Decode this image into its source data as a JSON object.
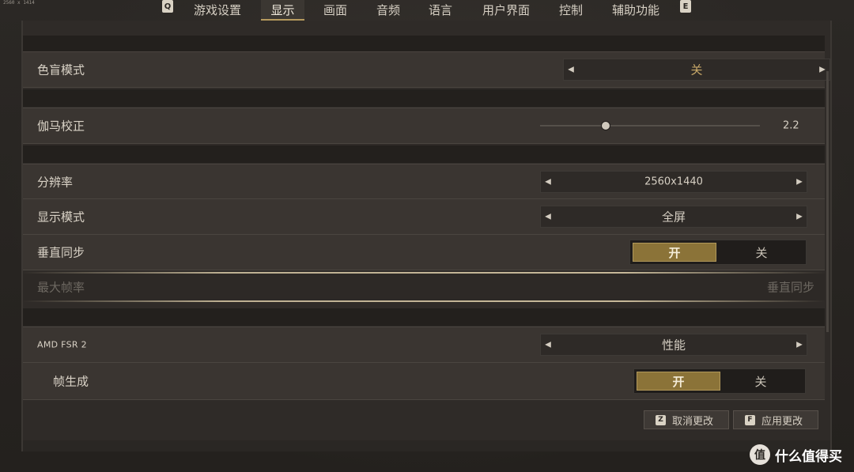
{
  "resolution_label": "2560 x 1414",
  "nav": {
    "left_key": "Q",
    "right_key": "E",
    "tabs": [
      "游戏设置",
      "显示",
      "画面",
      "音频",
      "语言",
      "用户界面",
      "控制",
      "辅助功能"
    ],
    "active_tab": "显示"
  },
  "settings": {
    "colorblind": {
      "label": "色盲模式",
      "value": "关"
    },
    "gamma": {
      "label": "伽马校正",
      "value": "2.2",
      "fraction": 0.3
    },
    "resolution": {
      "label": "分辨率",
      "value": "2560x1440"
    },
    "display_mode": {
      "label": "显示模式",
      "value": "全屏"
    },
    "vsync": {
      "label": "垂直同步",
      "on": "开",
      "off": "关",
      "selected": "开"
    },
    "max_fps": {
      "label": "最大帧率",
      "value": "垂直同步",
      "disabled": true
    },
    "fsr": {
      "label": "AMD FSR 2",
      "value": "性能"
    },
    "frame_gen": {
      "label": "帧生成",
      "on": "开",
      "off": "关",
      "selected": "开"
    }
  },
  "footer": {
    "cancel": {
      "key": "Z",
      "label": "取消更改"
    },
    "apply": {
      "key": "F",
      "label": "应用更改"
    }
  },
  "watermark": {
    "logo": "值",
    "text": "什么值得买"
  },
  "colors": {
    "accent_gold": "#8b7338",
    "background": "#2f2b28"
  }
}
